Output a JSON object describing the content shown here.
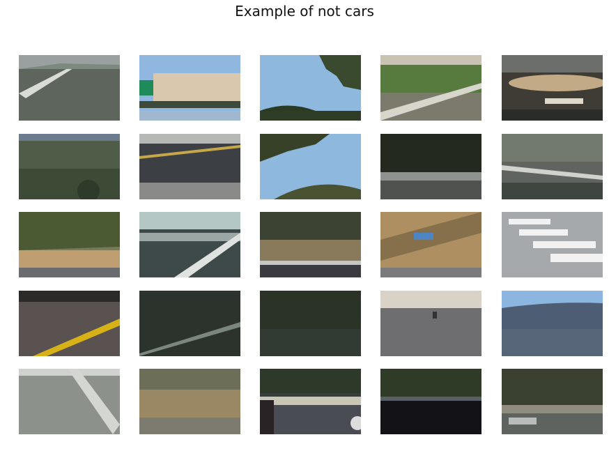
{
  "figure": {
    "title": "Example of not cars"
  },
  "tiles": [
    {
      "desc": "road-lane"
    },
    {
      "desc": "highway-sign"
    },
    {
      "desc": "sky-tree"
    },
    {
      "desc": "grass-median"
    },
    {
      "desc": "dirt-guardrail"
    },
    {
      "desc": "hills"
    },
    {
      "desc": "asphalt-curve"
    },
    {
      "desc": "tree-sky"
    },
    {
      "desc": "dark-barrier"
    },
    {
      "desc": "grey-lanes"
    },
    {
      "desc": "dry-brush"
    },
    {
      "desc": "guardrail-signs"
    },
    {
      "desc": "hill-road"
    },
    {
      "desc": "dry-slope-sign"
    },
    {
      "desc": "crosswalk"
    },
    {
      "desc": "yellow-line"
    },
    {
      "desc": "dark-road-1"
    },
    {
      "desc": "dark-road-2"
    },
    {
      "desc": "overpass"
    },
    {
      "desc": "blue-hills"
    },
    {
      "desc": "pale-lane"
    },
    {
      "desc": "dry-grass"
    },
    {
      "desc": "car-edge-road"
    },
    {
      "desc": "dark-shadow"
    },
    {
      "desc": "trees-rail"
    }
  ]
}
